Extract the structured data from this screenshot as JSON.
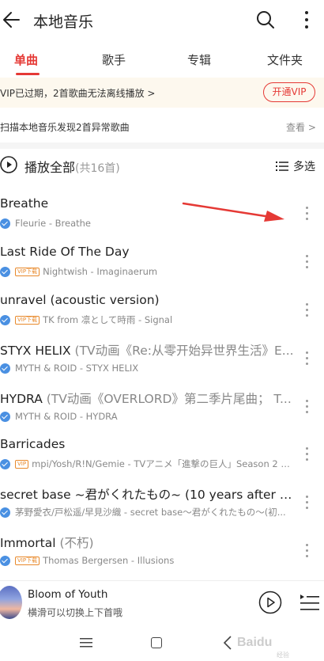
{
  "header": {
    "title": "本地音乐"
  },
  "tabs": [
    {
      "label": "单曲",
      "active": true
    },
    {
      "label": "歌手",
      "active": false
    },
    {
      "label": "专辑",
      "active": false
    },
    {
      "label": "文件夹",
      "active": false
    }
  ],
  "vip_notice": {
    "text": "VIP已过期，2首歌曲无法离线播放 >",
    "button": "开通VIP"
  },
  "scan": {
    "text": "扫描本地音乐发现2首异常歌曲",
    "link": "查看 >"
  },
  "play_all": {
    "label": "播放全部",
    "count": "(共16首)",
    "multi_select": "多选"
  },
  "songs": [
    {
      "title": "Breathe",
      "title_extra": "",
      "vip": "",
      "meta": "Fleurie - Breathe"
    },
    {
      "title": "Last Ride Of The Day",
      "title_extra": "",
      "vip": "VIP下载",
      "meta": "Nightwish - Imaginaerum"
    },
    {
      "title": "unravel (acoustic version)",
      "title_extra": "",
      "vip": "VIP下载",
      "meta": "TK from 凛として時雨 - Signal"
    },
    {
      "title": "STYX HELIX",
      "title_extra": " (TV动画《Re:从零开始异世界生活》E...",
      "vip": "",
      "meta": "MYTH & ROID - STYX HELIX"
    },
    {
      "title": "HYDRA",
      "title_extra": " (TV动画《OVERLORD》第二季片尾曲； T...",
      "vip": "",
      "meta": "MYTH & ROID - HYDRA"
    },
    {
      "title": "Barricades",
      "title_extra": "",
      "vip": "VIP",
      "meta": "mpi/Yosh/R!N/Gemie - TVアニメ「進撃の巨人」Season 2 オ..."
    },
    {
      "title": "secret base ~君がくれたもの~ (10 years after Ver...",
      "title_extra": "",
      "vip": "",
      "meta": "茅野愛衣/戸松遥/早見沙織 - secret base～君がくれたもの～(初..."
    },
    {
      "title": "Immortal",
      "title_extra": " (不朽)",
      "vip": "VIP下载",
      "meta": "Thomas Bergersen - Illusions"
    }
  ],
  "player": {
    "title": "Bloom of Youth",
    "hint": "横滑可以切换上下首哦"
  },
  "watermark": {
    "text": "Baidu",
    "sub": "经验"
  },
  "colors": {
    "accent": "#e53935",
    "check": "#4a90e2",
    "vip": "#e8892b"
  }
}
